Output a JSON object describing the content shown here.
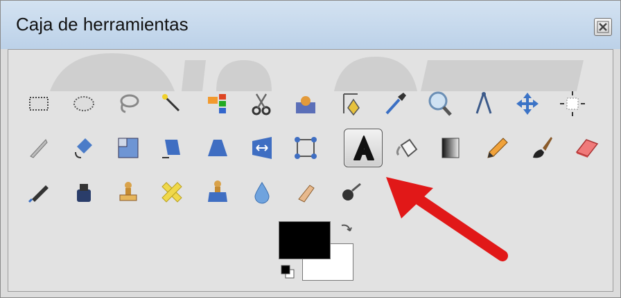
{
  "window": {
    "title": "Caja de herramientas"
  },
  "tools": [
    {
      "name": "rect-select-tool"
    },
    {
      "name": "ellipse-select-tool"
    },
    {
      "name": "free-select-tool"
    },
    {
      "name": "fuzzy-select-tool"
    },
    {
      "name": "select-by-color-tool"
    },
    {
      "name": "scissors-select-tool"
    },
    {
      "name": "foreground-select-tool"
    },
    {
      "name": "paths-tool"
    },
    {
      "name": "color-picker-tool"
    },
    {
      "name": "zoom-tool"
    },
    {
      "name": "measure-tool"
    },
    {
      "name": "move-tool"
    },
    {
      "name": "alignment-tool"
    },
    {
      "name": "crop-tool"
    },
    {
      "name": "rotate-tool"
    },
    {
      "name": "scale-tool"
    },
    {
      "name": "shear-tool"
    },
    {
      "name": "perspective-tool"
    },
    {
      "name": "flip-tool"
    },
    {
      "name": "cage-transform-tool"
    },
    {
      "name": "text-tool",
      "active": true
    },
    {
      "name": "bucket-fill-tool"
    },
    {
      "name": "blend-tool"
    },
    {
      "name": "pencil-tool"
    },
    {
      "name": "paintbrush-tool"
    },
    {
      "name": "eraser-tool"
    },
    {
      "name": "airbrush-tool"
    },
    {
      "name": "ink-tool"
    },
    {
      "name": "clone-tool"
    },
    {
      "name": "heal-tool"
    },
    {
      "name": "perspective-clone-tool"
    },
    {
      "name": "blur-sharpen-tool"
    },
    {
      "name": "smudge-tool"
    },
    {
      "name": "dodge-burn-tool"
    }
  ],
  "colors": {
    "foreground": "#000000",
    "background": "#ffffff"
  },
  "accent": {
    "arrow": "#e11818"
  }
}
